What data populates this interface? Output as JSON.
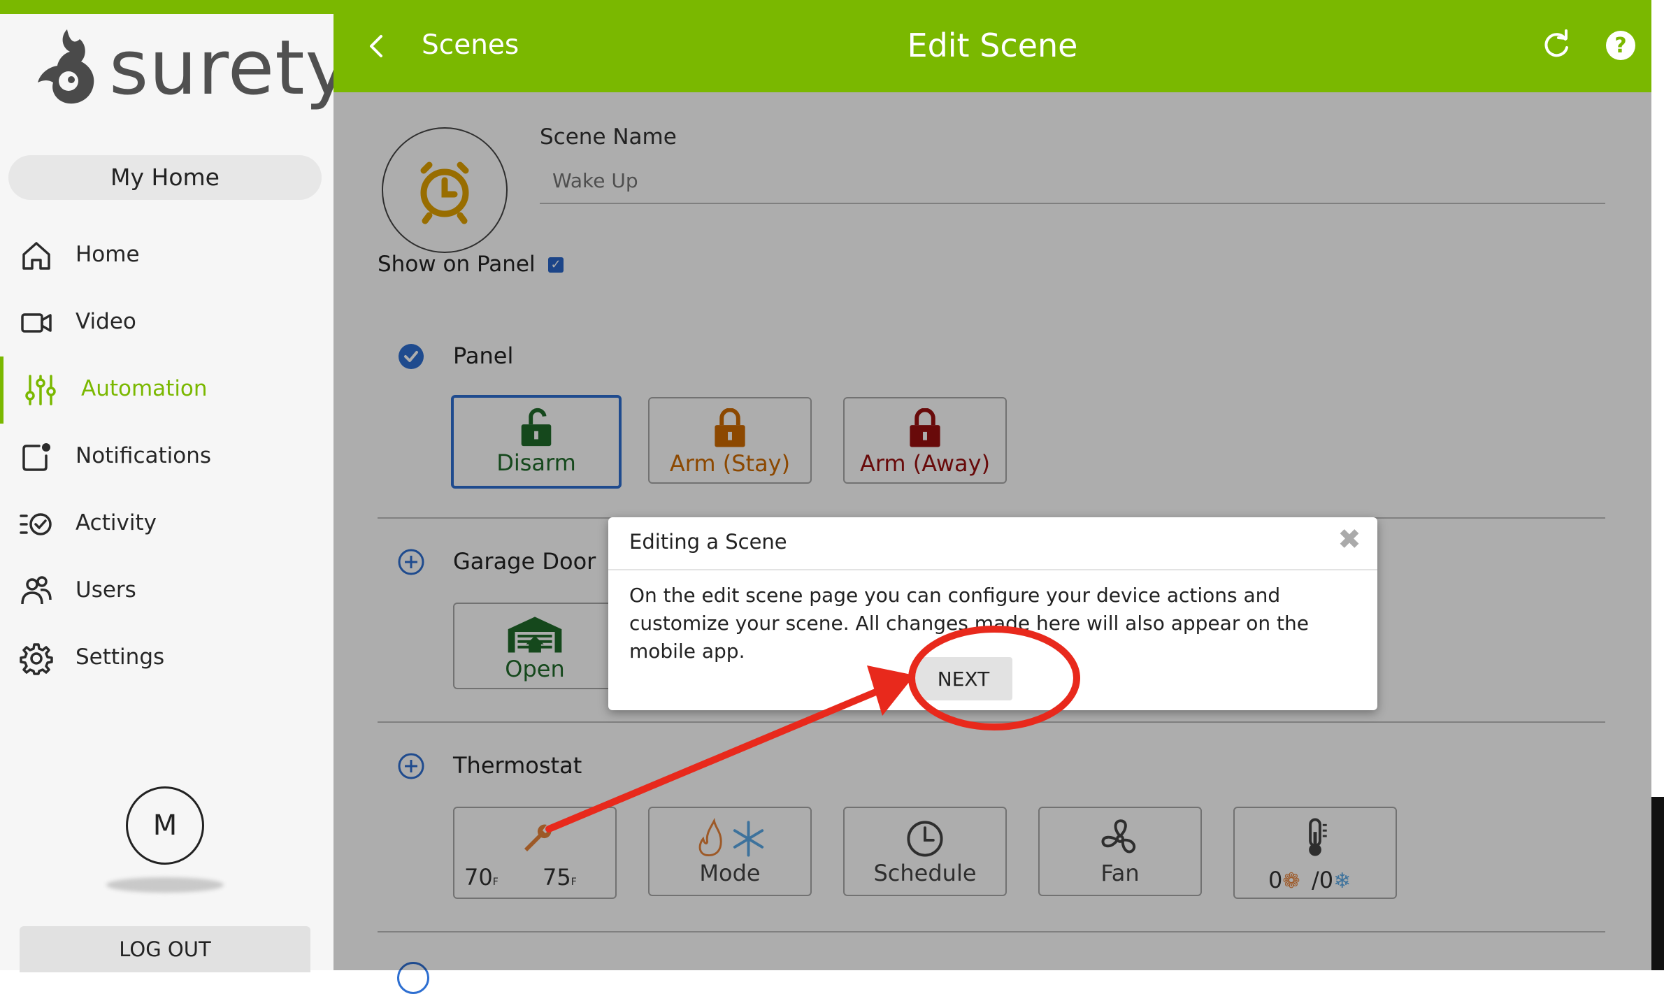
{
  "app": {
    "logo_text": "surety",
    "location": "My Home",
    "brand_color": "#7ab800"
  },
  "sidebar": {
    "items": [
      {
        "label": "Home",
        "icon": "home-icon"
      },
      {
        "label": "Video",
        "icon": "video-camera-icon"
      },
      {
        "label": "Automation",
        "icon": "sliders-icon",
        "active": true
      },
      {
        "label": "Notifications",
        "icon": "notification-icon"
      },
      {
        "label": "Activity",
        "icon": "activity-list-icon"
      },
      {
        "label": "Users",
        "icon": "users-icon"
      },
      {
        "label": "Settings",
        "icon": "gear-icon"
      }
    ],
    "avatar_initial": "M",
    "logout_label": "LOG OUT"
  },
  "header": {
    "back_label": "Scenes",
    "title": "Edit Scene"
  },
  "scene": {
    "name_label": "Scene Name",
    "name_placeholder": "Wake Up",
    "show_on_panel_label": "Show on Panel",
    "show_on_panel_checked": true,
    "icon": "alarm-clock-icon"
  },
  "sections": {
    "panel": {
      "title": "Panel",
      "options": [
        {
          "label": "Disarm",
          "color": "#1f6b2a",
          "icon": "unlocked-padlock-icon",
          "selected": true
        },
        {
          "label": "Arm (Stay)",
          "color": "#cf6a00",
          "icon": "padlock-icon"
        },
        {
          "label": "Arm (Away)",
          "color": "#9a1010",
          "icon": "padlock-icon"
        }
      ]
    },
    "garage": {
      "title": "Garage Door",
      "options": [
        {
          "label": "Open",
          "color": "#1f6b2a",
          "icon": "garage-icon"
        }
      ]
    },
    "thermostat": {
      "title": "Thermostat",
      "setpoint_low": "70",
      "setpoint_high": "75",
      "unit": "F",
      "mode_label": "Mode",
      "schedule_label": "Schedule",
      "fan_label": "Fan",
      "limits_heat": "0",
      "limits_cool": "/0"
    }
  },
  "modal": {
    "title": "Editing a Scene",
    "body": "On the edit scene page you can configure your device actions and customize your scene. All changes made here will also appear on the mobile app.",
    "next_label": "NEXT"
  }
}
